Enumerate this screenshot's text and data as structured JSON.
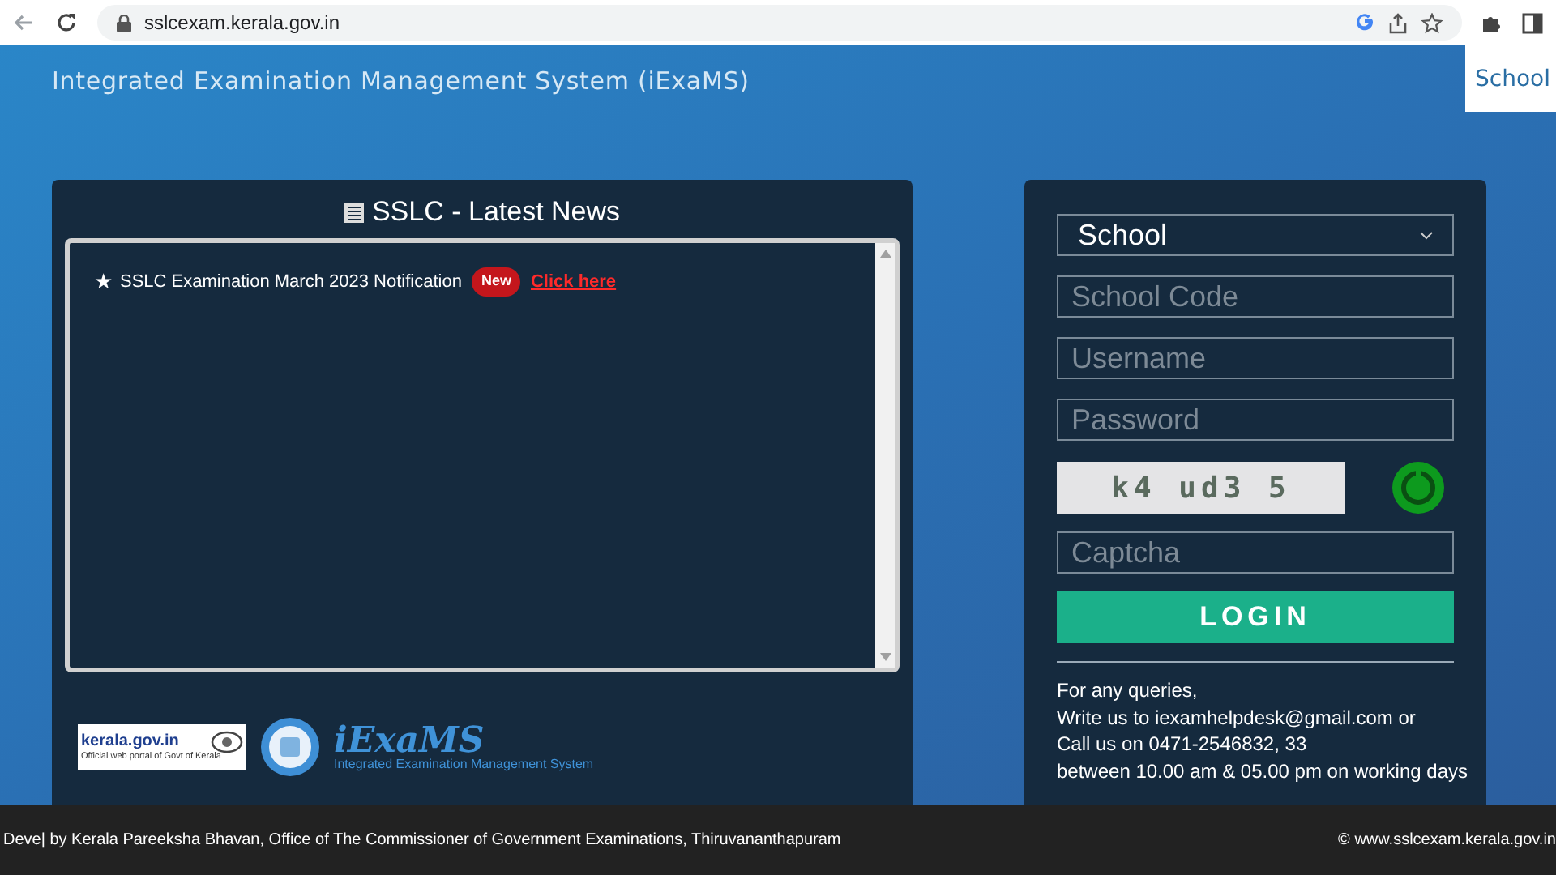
{
  "browser": {
    "url": "sslcexam.kerala.gov.in"
  },
  "header": {
    "title": "Integrated Examination Management System (iExaMS)",
    "tab": "School"
  },
  "news": {
    "title": "SSLC - Latest News",
    "items": [
      {
        "star": "★",
        "text": "SSLC Examination March 2023 Notification",
        "badge": "New",
        "link": "Click here"
      }
    ]
  },
  "logos": {
    "kerala": {
      "name": "kerala.gov.in",
      "tagline": "Official web portal of Govt of Kerala"
    },
    "iexams": {
      "name": "iExaMS",
      "tagline": "Integrated Examination Management System"
    }
  },
  "login": {
    "select": "School",
    "fields": [
      {
        "placeholder": "School Code"
      },
      {
        "placeholder": "Username"
      },
      {
        "placeholder": "Password"
      }
    ],
    "captcha": "k4 ud3 5",
    "captcha_field": {
      "placeholder": "Captcha"
    },
    "button": "LOGIN",
    "contact": [
      "For any queries,",
      "Write us to iexamhelpdesk@gmail.com or",
      "Call us on 0471-2546832, 33",
      "between 10.00 am & 05.00 pm on working days"
    ]
  },
  "footer": {
    "left": "Deve| by Kerala Pareeksha Bhavan, Office of The Commissioner of Government Examinations, Thiruvananthapuram",
    "right": "© www.sslcexam.kerala.gov.in"
  }
}
